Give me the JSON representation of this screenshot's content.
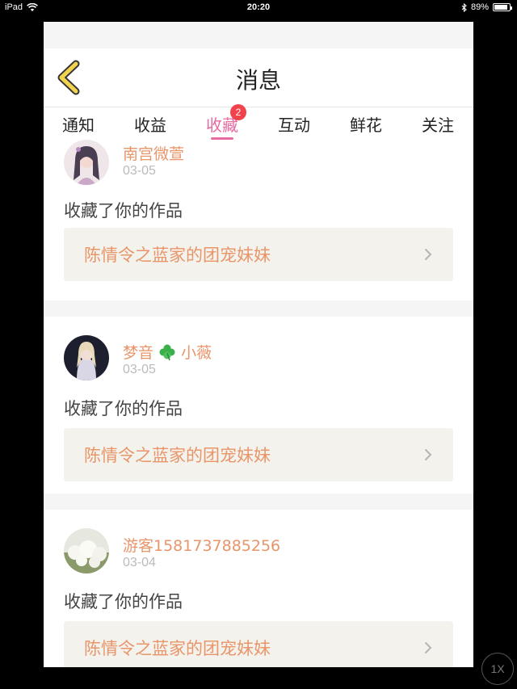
{
  "status_bar": {
    "device": "iPad",
    "time": "20:20",
    "battery": "89%",
    "battery_level": 0.89
  },
  "header": {
    "title": "消息"
  },
  "tabs": [
    {
      "label": "通知",
      "active": false
    },
    {
      "label": "收益",
      "active": false
    },
    {
      "label": "收藏",
      "active": true,
      "badge": "2"
    },
    {
      "label": "互动",
      "active": false
    },
    {
      "label": "鲜花",
      "active": false
    },
    {
      "label": "关注",
      "active": false
    }
  ],
  "notifications": [
    {
      "username": "南宫微萱",
      "date": "03-05",
      "action": "收藏了你的作品",
      "work_title": "陈情令之蓝家的团宠妹妹"
    },
    {
      "username_part1": "梦音",
      "username_part2": "小薇",
      "date": "03-05",
      "action": "收藏了你的作品",
      "work_title": "陈情令之蓝家的团宠妹妹"
    },
    {
      "username": "游客1581737885256",
      "date": "03-04",
      "action": "收藏了你的作品",
      "work_title": "陈情令之蓝家的团宠妹妹"
    }
  ],
  "zoom_button": "1X",
  "colors": {
    "accent_pink": "#e86aa1",
    "username_orange": "#e8956a",
    "badge_red": "#f2434c",
    "back_arrow_yellow": "#f2d34f"
  }
}
